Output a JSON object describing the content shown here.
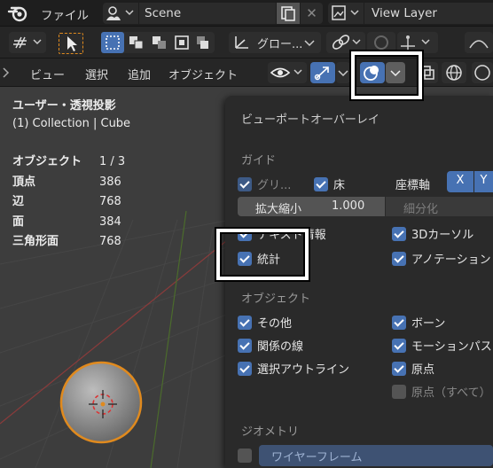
{
  "topbar": {
    "file_menu": "ファイル",
    "scene_name": "Scene",
    "view_layer": "View Layer"
  },
  "toolbar": {
    "orientation": "グロー..."
  },
  "header": {
    "view": "ビュー",
    "select": "選択",
    "add": "追加",
    "object": "オブジェクト"
  },
  "viewport": {
    "view_name": "ユーザー・透視投影",
    "collection": "(1) Collection | Cube",
    "stats": [
      {
        "key": "オブジェクト",
        "value": "1 / 3"
      },
      {
        "key": "頂点",
        "value": "386"
      },
      {
        "key": "辺",
        "value": "768"
      },
      {
        "key": "面",
        "value": "384"
      },
      {
        "key": "三角形面",
        "value": "768"
      }
    ]
  },
  "overlay": {
    "title": "ビューポートオーバーレイ",
    "guides_label": "ガイド",
    "grid": "グリ...",
    "floor": "床",
    "axes_label": "座標軸",
    "axis_x": "X",
    "axis_y": "Y",
    "scale_label": "拡大縮小",
    "scale_value": "1.000",
    "subdivision": "細分化",
    "text_info": "テキスト情報",
    "cursor_3d": "3Dカーソル",
    "statistics": "統計",
    "annotations": "アノテーション",
    "objects_label": "オブジェクト",
    "extras": "その他",
    "bones": "ボーン",
    "relations": "関係の線",
    "motion_paths": "モーションパス",
    "outline": "選択アウトライン",
    "origins": "原点",
    "origins_all": "原点（すべて）",
    "geometry_label": "ジオメトリ",
    "wireframe": "ワイヤーフレーム"
  },
  "colors": {
    "accent": "#4772b3",
    "select_orange": "#e08a1e",
    "highlight": "#ffffff"
  }
}
